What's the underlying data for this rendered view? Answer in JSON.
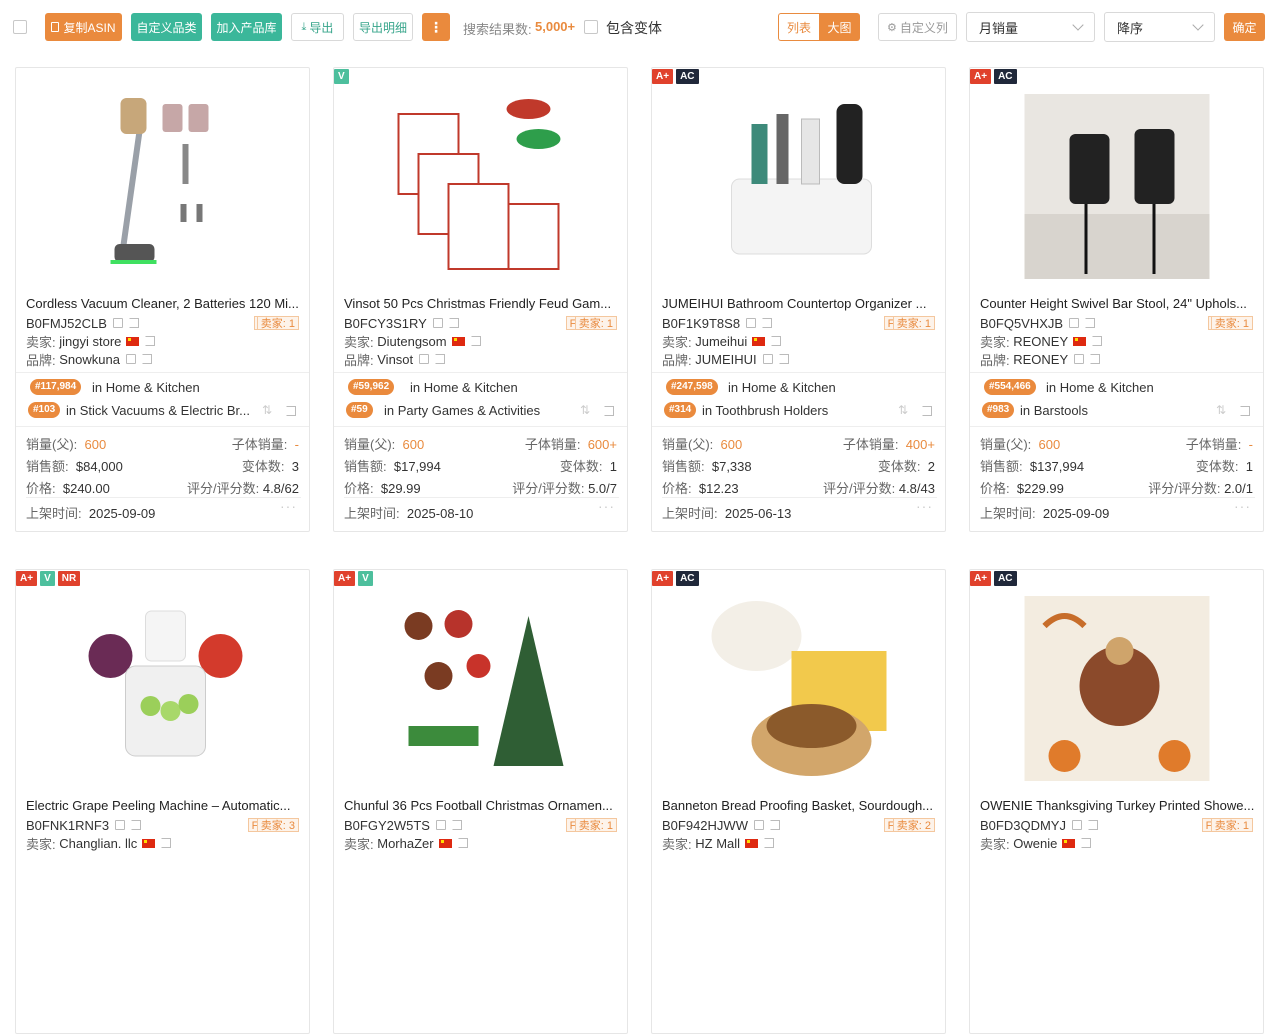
{
  "toolbar": {
    "copy_asin": "复制ASIN",
    "custom_category": "自定义品类",
    "add_to_library": "加入产品库",
    "export": "导出",
    "export_detail": "导出明细",
    "more": "⋮",
    "result_label": "搜索结果数:",
    "result_count": "5,000+",
    "include_variants": "包含变体",
    "view_list": "列表",
    "view_large": "大图",
    "custom_columns": "自定义列",
    "sort_field": "月销量",
    "sort_order": "降序",
    "confirm": "确定"
  },
  "labels": {
    "seller": "卖家:",
    "brand": "品牌:",
    "sales_parent": "销量(父):",
    "child_sales": "子体销量:",
    "revenue": "销售额:",
    "variants": "变体数:",
    "price": "价格:",
    "rating": "评分/评分数:",
    "listed": "上架时间:",
    "in": "in",
    "seller_count_prefix": "卖家:"
  },
  "products": [
    {
      "badges": [],
      "title": "Cordless Vacuum Cleaner, 2 Batteries 120 Mi...",
      "asin": "B0FMJ52CLB",
      "fulfillment": "NA",
      "seller_count": "卖家: 1",
      "seller": "jingyi store",
      "brand": "Snowkuna",
      "rank1": "#117,984",
      "cat1": "Home & Kitchen",
      "rank2": "#103",
      "cat2": "Stick Vacuums & Electric Br...",
      "sales_parent": "600",
      "child_sales": "-",
      "revenue": "$84,000",
      "variants": "3",
      "price": "$240.00",
      "rating": "4.8/62",
      "listed": "2025-09-09"
    },
    {
      "badges": [
        "V"
      ],
      "title": "Vinsot 50 Pcs Christmas Friendly Feud Gam...",
      "asin": "B0FCY3S1RY",
      "fulfillment": "FBA",
      "seller_count": "卖家: 1",
      "seller": "Diutengsom",
      "brand": "Vinsot",
      "rank1": "#59,962",
      "cat1": "Home & Kitchen",
      "rank2": "#59",
      "cat2": "Party Games & Activities",
      "sales_parent": "600",
      "child_sales": "600+",
      "revenue": "$17,994",
      "variants": "1",
      "price": "$29.99",
      "rating": "5.0/7",
      "listed": "2025-08-10"
    },
    {
      "badges": [
        "A+",
        "AC"
      ],
      "title": "JUMEIHUI Bathroom Countertop Organizer ...",
      "asin": "B0F1K9T8S8",
      "fulfillment": "FBA",
      "seller_count": "卖家: 1",
      "seller": "Jumeihui",
      "brand": "JUMEIHUI",
      "rank1": "#247,598",
      "cat1": "Home & Kitchen",
      "rank2": "#314",
      "cat2": "Toothbrush Holders",
      "sales_parent": "600",
      "child_sales": "400+",
      "revenue": "$7,338",
      "variants": "2",
      "price": "$12.23",
      "rating": "4.8/43",
      "listed": "2025-06-13"
    },
    {
      "badges": [
        "A+",
        "AC"
      ],
      "title": "Counter Height Swivel Bar Stool, 24\" Uphols...",
      "asin": "B0FQ5VHXJB",
      "fulfillment": "NA",
      "seller_count": "卖家: 1",
      "seller": "REONEY",
      "brand": "REONEY",
      "rank1": "#554,466",
      "cat1": "Home & Kitchen",
      "rank2": "#983",
      "cat2": "Barstools",
      "sales_parent": "600",
      "child_sales": "-",
      "revenue": "$137,994",
      "variants": "1",
      "price": "$229.99",
      "rating": "2.0/1",
      "listed": "2025-09-09"
    },
    {
      "badges": [
        "A+",
        "V",
        "NR"
      ],
      "title": "Electric Grape Peeling Machine – Automatic...",
      "asin": "B0FNK1RNF3",
      "fulfillment": "FBA",
      "seller_count": "卖家: 3",
      "seller": "Changlian. llc"
    },
    {
      "badges": [
        "A+",
        "V"
      ],
      "title": "Chunful 36 Pcs Football Christmas Ornamen...",
      "asin": "B0FGY2W5TS",
      "fulfillment": "FBA",
      "seller_count": "卖家: 1",
      "seller": "MorhaZer"
    },
    {
      "badges": [
        "A+",
        "AC"
      ],
      "title": "Banneton Bread Proofing Basket, Sourdough...",
      "asin": "B0F942HJWW",
      "fulfillment": "FBA",
      "seller_count": "卖家: 2",
      "seller": "HZ Mall"
    },
    {
      "badges": [
        "A+",
        "AC"
      ],
      "title": "OWENIE Thanksgiving Turkey Printed Showe...",
      "asin": "B0FD3QDMYJ",
      "fulfillment": "FBA",
      "seller_count": "卖家: 1",
      "seller": "Owenie"
    }
  ]
}
